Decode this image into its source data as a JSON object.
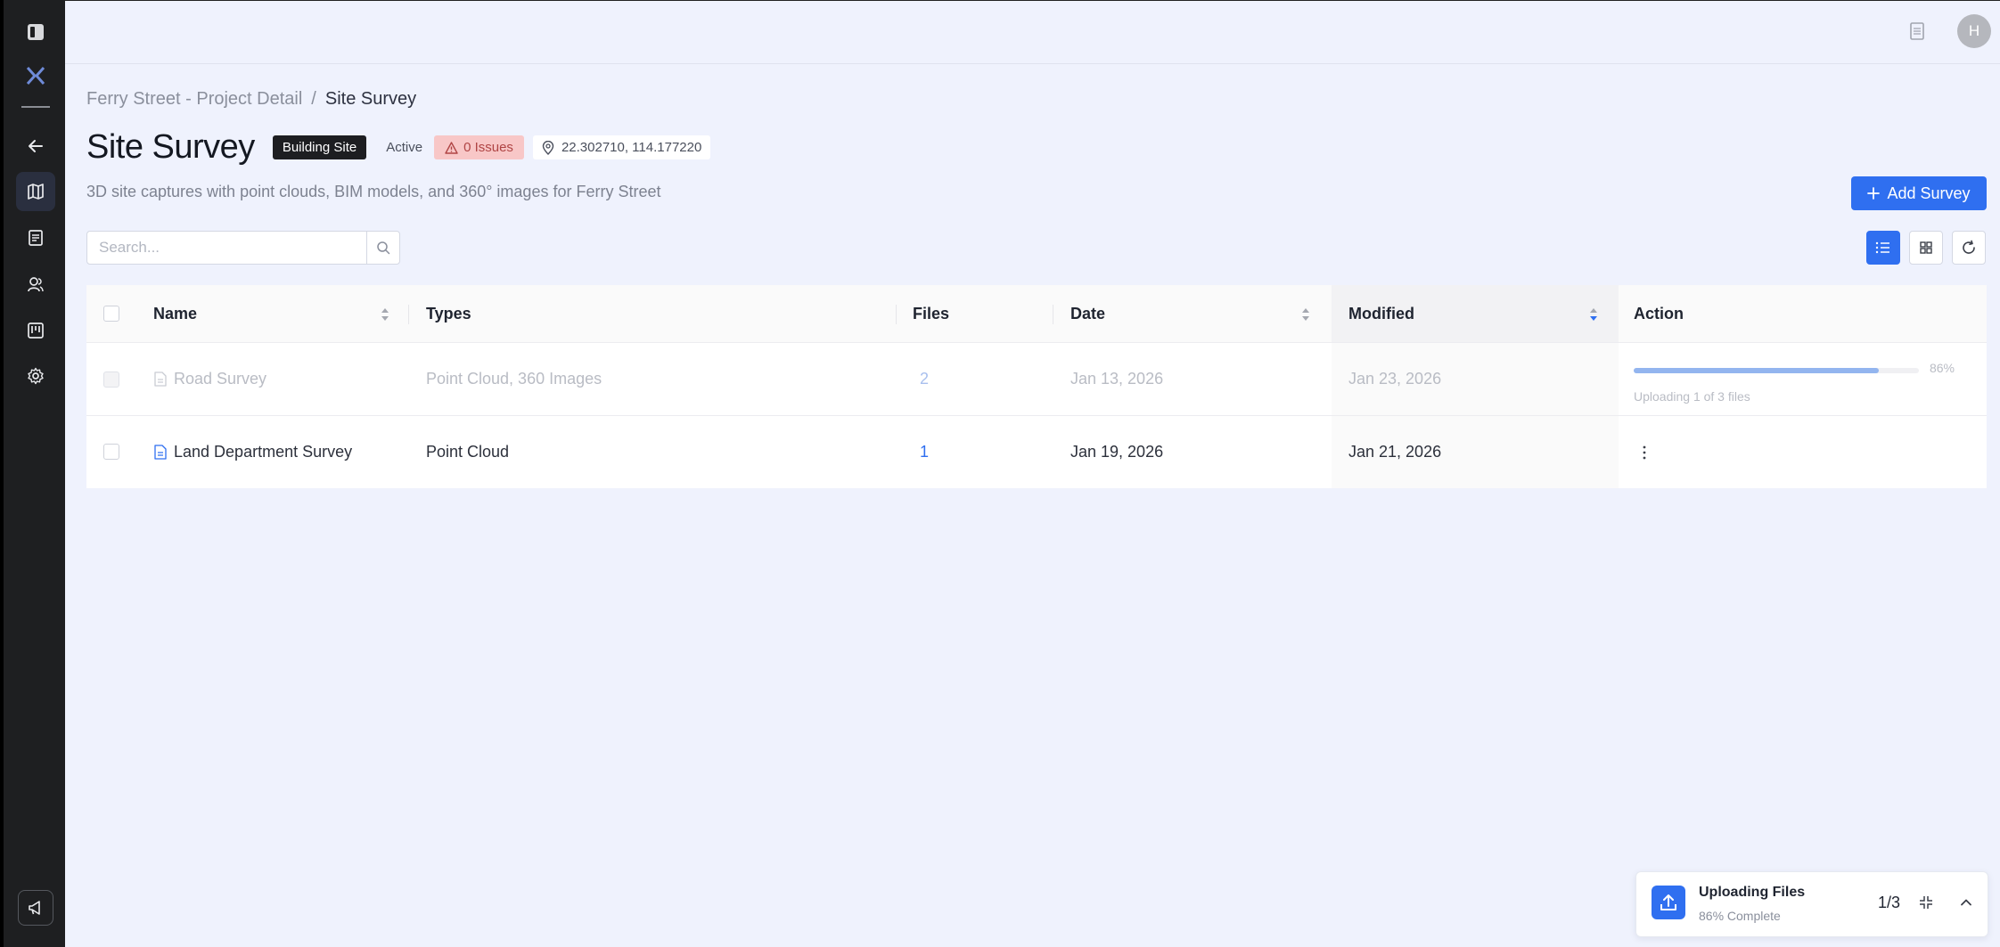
{
  "user": {
    "avatar_initial": "H"
  },
  "breadcrumb": {
    "parent": "Ferry Street - Project Detail",
    "separator": "/",
    "current": "Site Survey"
  },
  "header": {
    "title": "Site Survey",
    "type_badge": "Building Site",
    "status": "Active",
    "issues_badge": "0 Issues",
    "coordinates": "22.302710, 114.177220",
    "subtitle": "3D site captures with point clouds, BIM models, and 360° images for Ferry Street",
    "add_button": "Add Survey"
  },
  "search": {
    "placeholder": "Search..."
  },
  "table": {
    "columns": [
      "Name",
      "Types",
      "Files",
      "Date",
      "Modified",
      "Action"
    ],
    "rows": [
      {
        "name": "Road Survey",
        "types": "Point Cloud, 360 Images",
        "files": "2",
        "date": "Jan 13, 2026",
        "modified": "Jan 23, 2026",
        "upload_progress": 86,
        "upload_pct_label": "86%",
        "upload_label": "Uploading 1 of 3 files"
      },
      {
        "name": "Land Department Survey",
        "types": "Point Cloud",
        "files": "1",
        "date": "Jan 19, 2026",
        "modified": "Jan 21, 2026"
      }
    ]
  },
  "upload_toast": {
    "title": "Uploading Files",
    "subtitle": "86% Complete",
    "count": "1/3"
  },
  "icons": {
    "sidebar": [
      "panel-toggle-icon",
      "logo-icon",
      "arrow-left-icon",
      "map-icon",
      "document-icon",
      "users-icon",
      "kanban-icon",
      "gear-icon",
      "megaphone-icon"
    ],
    "top": [
      "document-icon"
    ]
  },
  "colors": {
    "accent": "#2f6ff0",
    "sidebar_bg": "#1e1f21",
    "page_bg": "#eff2fd",
    "issues_bg": "#f8c7c7"
  }
}
